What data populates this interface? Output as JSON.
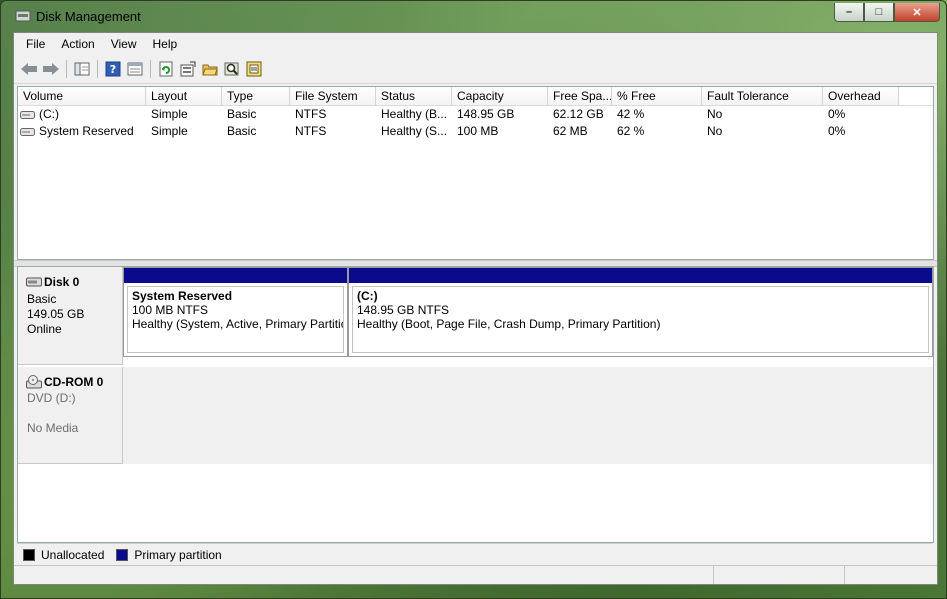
{
  "window": {
    "title": "Disk Management",
    "caption_buttons": {
      "minimize": "–",
      "maximize": "□",
      "close": "✕"
    }
  },
  "menu": {
    "items": [
      "File",
      "Action",
      "View",
      "Help"
    ]
  },
  "toolbar": {
    "icons": [
      "back-arrow-icon",
      "forward-arrow-icon",
      "show-hide-console-tree-icon",
      "help-icon",
      "properties-icon",
      "refresh-icon",
      "rescan-icon",
      "open-folder-icon",
      "search-icon",
      "show-window-icon"
    ]
  },
  "volume_list": {
    "columns": [
      "Volume",
      "Layout",
      "Type",
      "File System",
      "Status",
      "Capacity",
      "Free Spa...",
      "% Free",
      "Fault Tolerance",
      "Overhead"
    ],
    "rows": [
      [
        "(C:)",
        "Simple",
        "Basic",
        "NTFS",
        "Healthy (B...",
        "148.95 GB",
        "62.12 GB",
        "42 %",
        "No",
        "0%"
      ],
      [
        "System Reserved",
        "Simple",
        "Basic",
        "NTFS",
        "Healthy (S...",
        "100 MB",
        "62 MB",
        "62 %",
        "No",
        "0%"
      ]
    ]
  },
  "disks": {
    "disk0": {
      "name": "Disk 0",
      "type": "Basic",
      "size": "149.05 GB",
      "state": "Online",
      "partitions": [
        {
          "name": "System Reserved",
          "size": "100 MB NTFS",
          "status": "Healthy (System, Active, Primary Partitio"
        },
        {
          "name": "(C:)",
          "size": "148.95 GB NTFS",
          "status": "Healthy (Boot, Page File, Crash Dump, Primary Partition)"
        }
      ]
    },
    "cdrom0": {
      "name": "CD-ROM 0",
      "type": "DVD (D:)",
      "media": "No Media"
    }
  },
  "legend": {
    "items": [
      {
        "label": "Unallocated",
        "color": "#000000"
      },
      {
        "label": "Primary partition",
        "color": "#0a0a8c"
      }
    ]
  },
  "colors": {
    "primary_partition": "#0a0a8c",
    "unallocated": "#000000",
    "window_bg": "#f0f0f0"
  }
}
